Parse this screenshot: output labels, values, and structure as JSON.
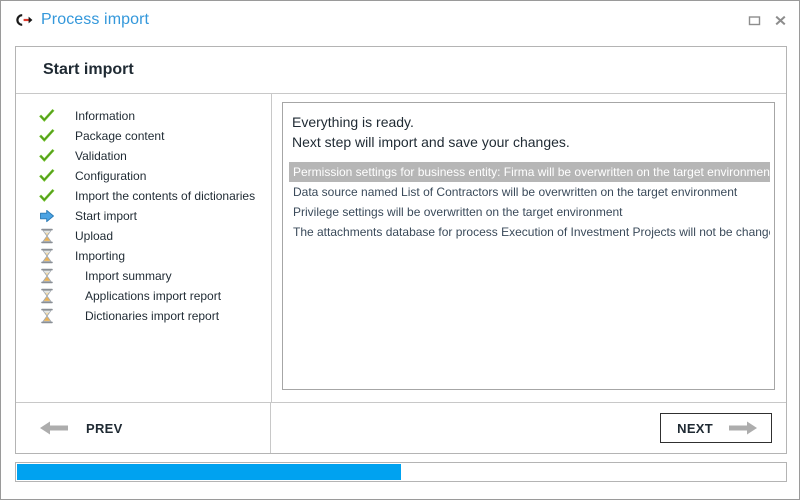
{
  "window": {
    "app_icon": "process-link-icon",
    "title": "Process import",
    "controls": [
      {
        "name": "maximize",
        "icon": "maximize-icon"
      },
      {
        "name": "close",
        "icon": "close-icon"
      }
    ]
  },
  "panel": {
    "title": "Start import"
  },
  "steps": [
    {
      "label": "Information",
      "status": "done",
      "icon": "check-icon",
      "sub": false
    },
    {
      "label": "Package content",
      "status": "done",
      "icon": "check-icon",
      "sub": false
    },
    {
      "label": "Validation",
      "status": "done",
      "icon": "check-icon",
      "sub": false
    },
    {
      "label": "Configuration",
      "status": "done",
      "icon": "check-icon",
      "sub": false
    },
    {
      "label": "Import the contents of dictionaries",
      "status": "done",
      "icon": "check-icon",
      "sub": false
    },
    {
      "label": "Start import",
      "status": "current",
      "icon": "arrow-right-icon",
      "sub": false
    },
    {
      "label": "Upload",
      "status": "pending",
      "icon": "hourglass-icon",
      "sub": false
    },
    {
      "label": "Importing",
      "status": "pending",
      "icon": "hourglass-icon",
      "sub": false
    },
    {
      "label": "Import summary",
      "status": "pending",
      "icon": "hourglass-icon",
      "sub": true
    },
    {
      "label": "Applications import report",
      "status": "pending",
      "icon": "hourglass-icon",
      "sub": true
    },
    {
      "label": "Dictionaries import report",
      "status": "pending",
      "icon": "hourglass-icon",
      "sub": true
    }
  ],
  "content": {
    "headline_1": "Everything is ready.",
    "headline_2": "Next step will import and save your changes.",
    "messages": [
      {
        "text": "Permission settings for business entity: Firma will be overwritten on the target environment",
        "selected": true
      },
      {
        "text": "Data source named List of Contractors will be overwritten on the target environment",
        "selected": false
      },
      {
        "text": "Privilege settings will be overwritten on the target environment",
        "selected": false
      },
      {
        "text": "The attachments database for process Execution of Investment Projects will not be changed.",
        "selected": false
      }
    ]
  },
  "footer": {
    "prev_label": "PREV",
    "prev_icon": "arrow-left-icon",
    "next_label": "NEXT",
    "next_icon": "arrow-right-icon"
  },
  "progress": {
    "percent": 50
  },
  "colors": {
    "title_blue": "#3498db",
    "progress_blue": "#00a2f0",
    "check_green": "#5aa72b",
    "arrow_blue": "#3a8fd8",
    "selected_gray": "#b6b6b6"
  }
}
